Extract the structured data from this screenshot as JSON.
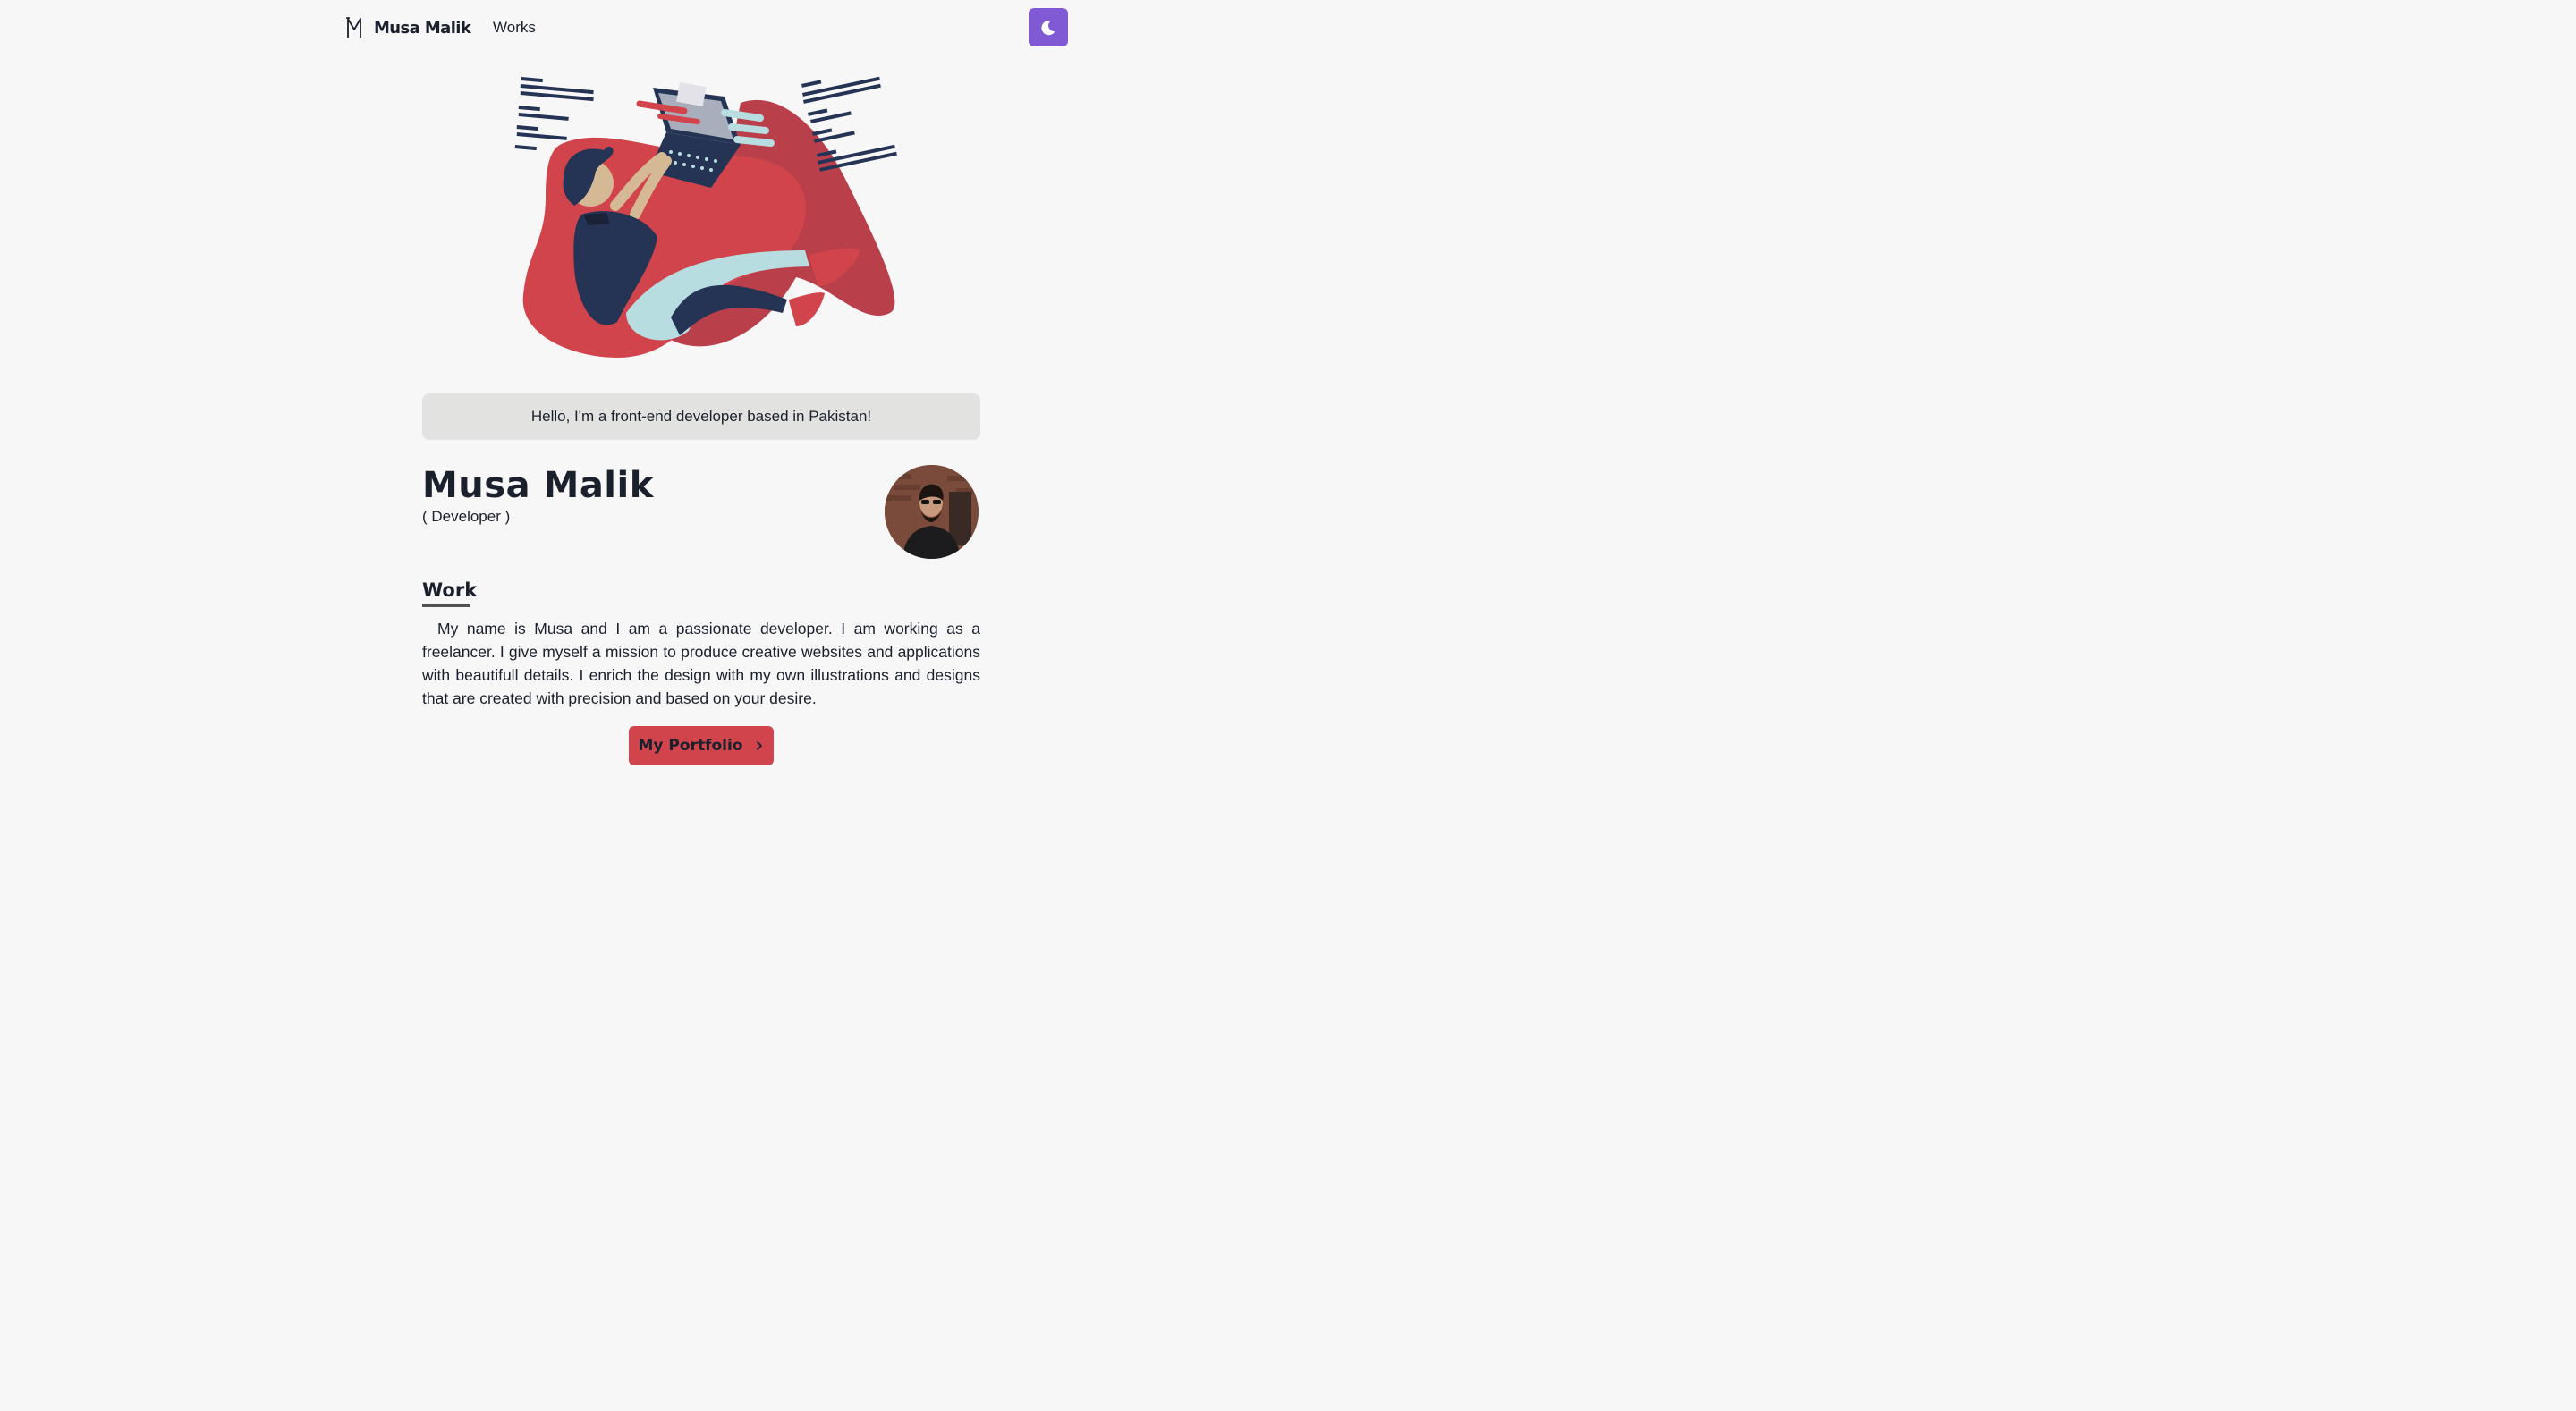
{
  "header": {
    "brand_name": "Musa Malik",
    "nav_links": [
      {
        "label": "Works"
      }
    ],
    "theme_toggle_icon": "moon-icon"
  },
  "hero": {
    "illustration": "developer-with-laptop-illustration",
    "greeting": "Hello, I'm a front-end developer based in Pakistan!"
  },
  "profile": {
    "name": "Musa Malik",
    "role": "( Developer )"
  },
  "work": {
    "title": "Work",
    "paragraph": "My name is Musa and I am a passionate developer. I am working as a freelancer. I give myself a mission to produce creative websites and applications with beautifull details. I enrich the design with my own illustrations and designs that are created with precision and based on your desire.",
    "button_label": "My Portfolio",
    "button_icon": "chevron-right-icon"
  },
  "colors": {
    "background": "#f7f7f8",
    "accent_purple": "#805ad5",
    "accent_red": "#d2444c",
    "text": "#1a202c"
  }
}
